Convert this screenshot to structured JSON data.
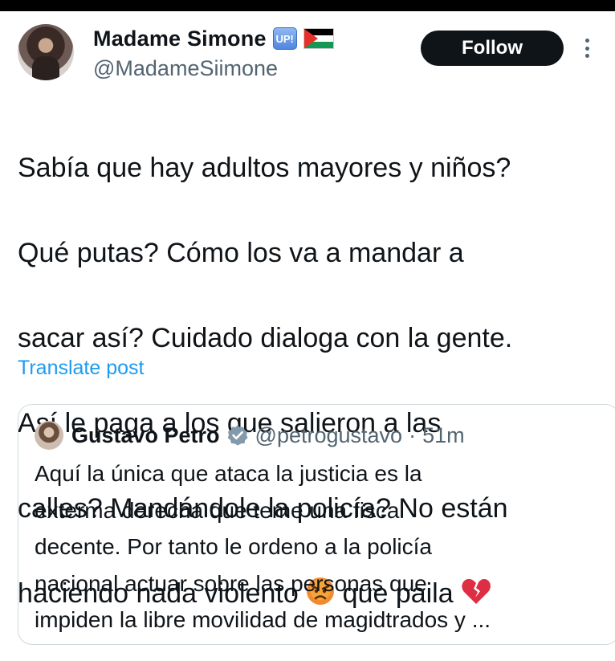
{
  "author": {
    "display_name": "Madame Simone",
    "badge_text": "UP!",
    "handle": "@MadameSiimone",
    "avatar_icon": "user-avatar"
  },
  "actions": {
    "follow_label": "Follow",
    "more_icon": "more-vertical-icon"
  },
  "tweet": {
    "lines": [
      "Sabía que hay adultos mayores y niños?",
      "Qué putas? Cómo los va a mandar a",
      "sacar así? Cuidado dialoga con la gente.",
      "Así le paga a los que salieron a las",
      "calles? Mandándole la policía? No están",
      "haciendo nada violento"
    ],
    "last_line_tail": "que paila",
    "emoji_angry": "😡",
    "emoji_broken_heart": "💔"
  },
  "translate_label": "Translate post",
  "quote": {
    "display_name": "Gustavo Petro",
    "handle": "@petrogustavo",
    "separator": "·",
    "time": "51m",
    "lines": [
      "Aquí la única que ataca la justicia es la",
      "exterma derecha que teme una fiscal",
      "decente. Por tanto le ordeno a la policía",
      "nacional actuar sobre las personas que",
      "impiden la libre movilidad de magidtrados y ..."
    ]
  },
  "colors": {
    "text": "#0f1419",
    "secondary": "#536471",
    "link": "#1d9bf0",
    "border": "#cfd9de",
    "button_bg": "#0f1419",
    "verified": "#829aab"
  }
}
